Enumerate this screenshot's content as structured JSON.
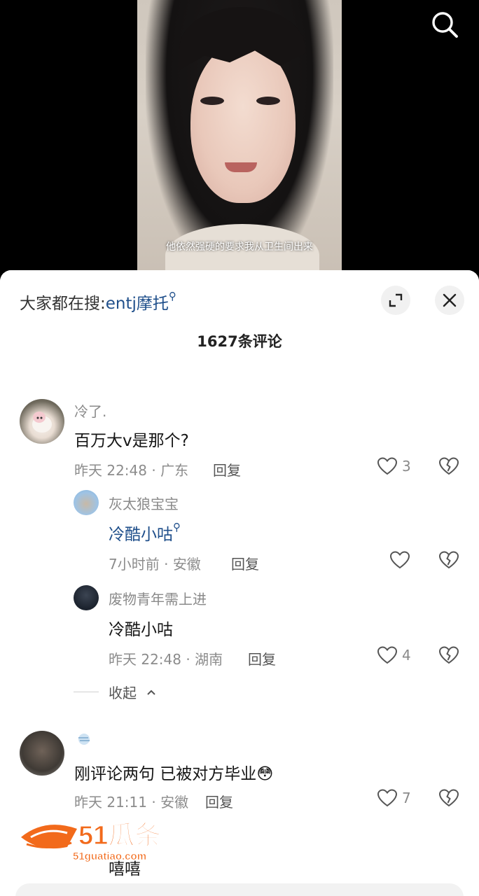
{
  "video": {
    "subtitle": "他依然强硬的要求我从卫生间出来"
  },
  "header": {
    "hot_search_prefix": "大家都在搜:",
    "hot_search_keyword": "entj摩托",
    "comment_count": "1627条评论"
  },
  "comments": [
    {
      "username": "冷了.",
      "text": "百万大v是那个?",
      "time": "昨天 22:48",
      "location": "广东",
      "reply_label": "回复",
      "likes": "3",
      "replies": [
        {
          "username": "灰太狼宝宝",
          "text": "冷酷小咕",
          "time": "7小时前",
          "location": "安徽",
          "reply_label": "回复",
          "likes": ""
        },
        {
          "username": "废物青年需上进",
          "text": "冷酷小咕",
          "time": "昨天 22:48",
          "location": "湖南",
          "reply_label": "回复",
          "likes": "4"
        }
      ],
      "collapse_label": "收起"
    },
    {
      "username": "",
      "text": "刚评论两句  已被对方毕业",
      "emoji": "😳",
      "time": "昨天 21:11",
      "location": "安徽",
      "reply_label": "回复",
      "likes": "7"
    },
    {
      "username": "",
      "text": "嘻嘻"
    }
  ],
  "watermark": {
    "logo_text": "51瓜条",
    "url": "51guatiao.com"
  },
  "icons": {
    "search": "search-icon",
    "expand": "expand-icon",
    "close": "close-icon",
    "like": "heart-icon",
    "dislike": "broken-heart-icon",
    "chevron": "chevron-up-icon"
  },
  "colors": {
    "link": "#1f4f8b",
    "meta": "#8c8c8c",
    "watermark": "#f26a1b"
  }
}
